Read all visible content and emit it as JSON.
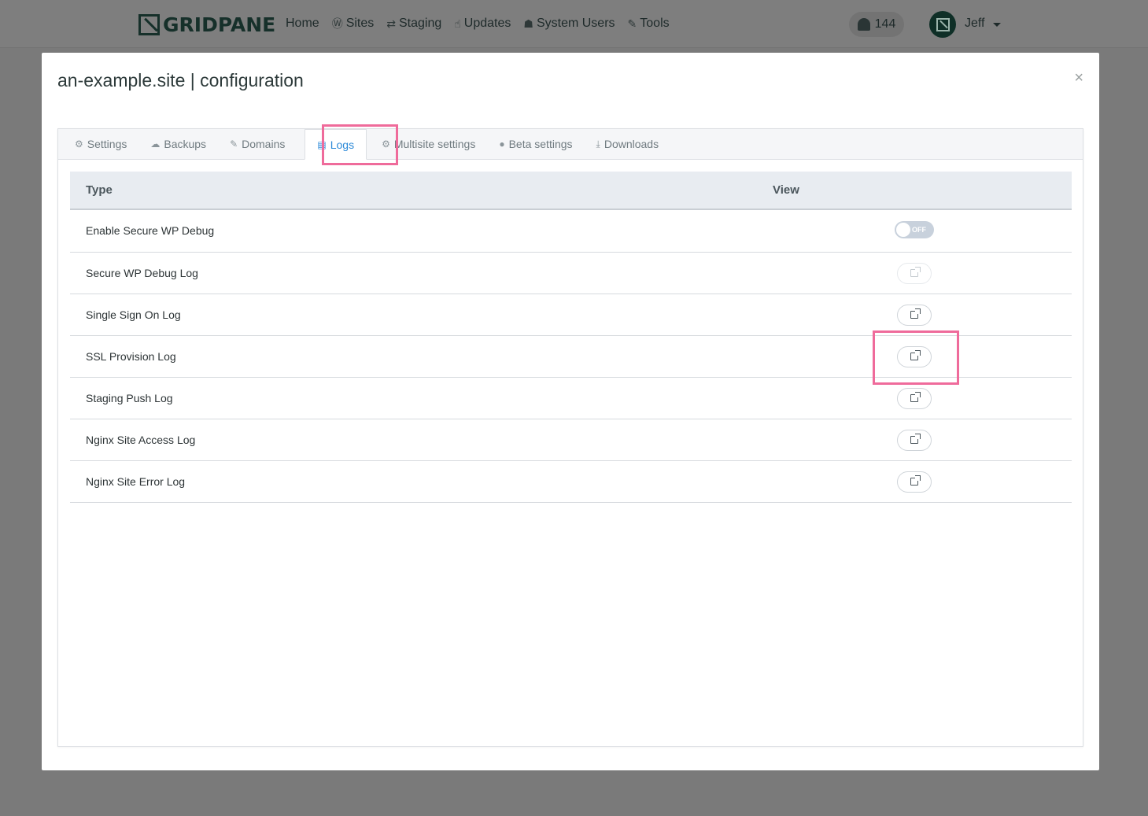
{
  "navbar": {
    "logo_text": "GRIDPANE",
    "links": [
      {
        "label": "Home",
        "icon": ""
      },
      {
        "label": "Sites",
        "icon": "wordpress-icon"
      },
      {
        "label": "Staging",
        "icon": "sync-icon"
      },
      {
        "label": "Updates",
        "icon": "thumbs-up-icon"
      },
      {
        "label": "System Users",
        "icon": "user-secret-icon"
      },
      {
        "label": "Tools",
        "icon": "wrench-icon"
      }
    ],
    "notifications_count": "144",
    "user_name": "Jeff"
  },
  "modal": {
    "title": "an-example.site | configuration",
    "close_glyph": "×",
    "tabs": [
      {
        "label": "Settings",
        "icon": "gear-icon",
        "glyph": "⚙"
      },
      {
        "label": "Backups",
        "icon": "cloud-icon",
        "glyph": "☁"
      },
      {
        "label": "Domains",
        "icon": "edit-icon",
        "glyph": "✎"
      },
      {
        "label": "Logs",
        "icon": "document-icon",
        "glyph": "▤"
      },
      {
        "label": "Multisite settings",
        "icon": "gear-icon",
        "glyph": "⚙"
      },
      {
        "label": "Beta settings",
        "icon": "info-icon",
        "glyph": "●"
      },
      {
        "label": "Downloads",
        "icon": "download-icon",
        "glyph": "⤓"
      }
    ],
    "active_tab": "Logs",
    "table": {
      "headers": {
        "type": "Type",
        "view": "View"
      },
      "rows": [
        {
          "type": "Enable Secure WP Debug",
          "control": "toggle",
          "toggle_label": "OFF"
        },
        {
          "type": "Secure WP Debug Log",
          "control": "button-disabled"
        },
        {
          "type": "Single Sign On Log",
          "control": "button"
        },
        {
          "type": "SSL Provision Log",
          "control": "button"
        },
        {
          "type": "Staging Push Log",
          "control": "button"
        },
        {
          "type": "Nginx Site Access Log",
          "control": "button"
        },
        {
          "type": "Nginx Site Error Log",
          "control": "button"
        }
      ]
    }
  },
  "colors": {
    "accent": "#2d8ad8",
    "highlight": "#ef6b9b",
    "backdrop": "#7a7a7a"
  }
}
